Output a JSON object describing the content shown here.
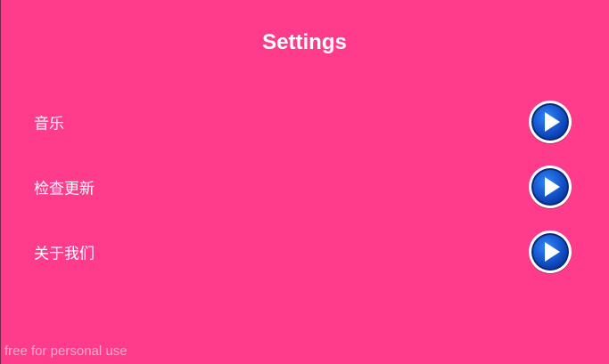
{
  "screen": {
    "title": "Settings",
    "background_color": "#ff3b8b",
    "watermark": "free for personal use"
  },
  "settings": {
    "items": [
      {
        "label": "音乐",
        "button_icon": "play-icon"
      },
      {
        "label": "检查更新",
        "button_icon": "play-icon"
      },
      {
        "label": "关于我们",
        "button_icon": "play-icon"
      }
    ]
  },
  "colors": {
    "button_blue": "#0a4fd6",
    "button_ring": "#ffffff",
    "label_text": "#ffffff"
  }
}
